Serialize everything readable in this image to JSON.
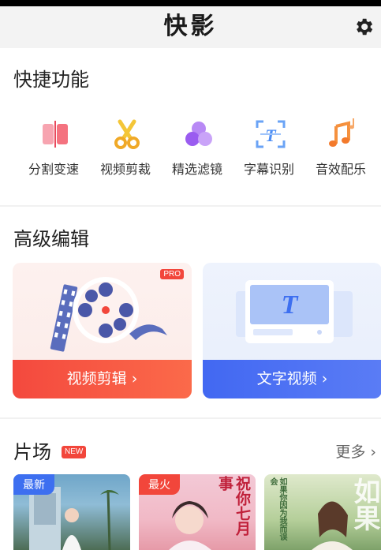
{
  "header": {
    "title": "快影"
  },
  "quick_functions": {
    "title": "快捷功能",
    "items": [
      {
        "label": "分割变速",
        "icon": "split-speed-icon"
      },
      {
        "label": "视频剪裁",
        "icon": "scissors-icon"
      },
      {
        "label": "精选滤镜",
        "icon": "filter-circles-icon"
      },
      {
        "label": "字幕识别",
        "icon": "subtitle-recognition-icon"
      },
      {
        "label": "音效配乐",
        "icon": "music-note-icon"
      }
    ]
  },
  "advanced_edit": {
    "title": "高级编辑",
    "cards": [
      {
        "button": "视频剪辑 ›",
        "badge": "PRO"
      },
      {
        "button": "文字视频 ›"
      }
    ]
  },
  "studio": {
    "title": "片场",
    "badge": "NEW",
    "more": "更多 ›",
    "thumbnails": [
      {
        "badge": "最新"
      },
      {
        "badge": "最火",
        "overlay_text": "祝你七月事"
      },
      {
        "overlay_text": "如果你因为我而误会",
        "overlay_big": "如果"
      }
    ]
  },
  "colors": {
    "accent_red": "#f2463b",
    "accent_blue": "#4268f2"
  }
}
